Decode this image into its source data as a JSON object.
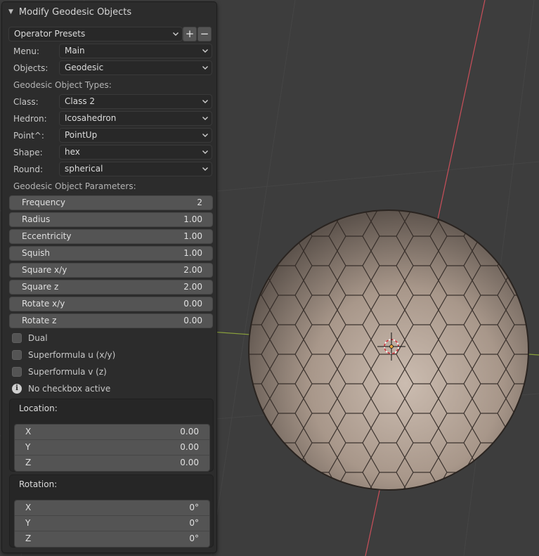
{
  "panel": {
    "title": "Modify Geodesic Objects",
    "presets_label": "Operator Presets",
    "add_symbol": "+",
    "remove_symbol": "−"
  },
  "dropdowns": {
    "menu": {
      "label": "Menu:",
      "value": "Main"
    },
    "objects": {
      "label": "Objects:",
      "value": "Geodesic"
    },
    "class": {
      "label": "Class:",
      "value": "Class 2"
    },
    "hedron": {
      "label": "Hedron:",
      "value": "Icosahedron"
    },
    "point": {
      "label": "Point^:",
      "value": "PointUp"
    },
    "shape": {
      "label": "Shape:",
      "value": "hex"
    },
    "round": {
      "label": "Round:",
      "value": "spherical"
    }
  },
  "sections": {
    "types": "Geodesic Object Types:",
    "params": "Geodesic Object Parameters:"
  },
  "params": [
    {
      "label": "Frequency",
      "value": "2"
    },
    {
      "label": "Radius",
      "value": "1.00"
    },
    {
      "label": "Eccentricity",
      "value": "1.00"
    },
    {
      "label": "Squish",
      "value": "1.00"
    },
    {
      "label": "Square x/y",
      "value": "2.00"
    },
    {
      "label": "Square z",
      "value": "2.00"
    },
    {
      "label": "Rotate x/y",
      "value": "0.00"
    },
    {
      "label": "Rotate z",
      "value": "0.00"
    }
  ],
  "checkboxes": [
    {
      "label": "Dual",
      "checked": false
    },
    {
      "label": "Superformula u (x/y)",
      "checked": false
    },
    {
      "label": "Superformula v (z)",
      "checked": false
    }
  ],
  "info": {
    "icon": "info-icon",
    "text": "No checkbox active"
  },
  "location": {
    "title": "Location:",
    "x": {
      "label": "X",
      "value": "0.00"
    },
    "y": {
      "label": "Y",
      "value": "0.00"
    },
    "z": {
      "label": "Z",
      "value": "0.00"
    }
  },
  "rotation": {
    "title": "Rotation:",
    "x": {
      "label": "X",
      "value": "0°"
    },
    "y": {
      "label": "Y",
      "value": "0°"
    },
    "z": {
      "label": "Z",
      "value": "0°"
    }
  },
  "colors": {
    "viewport_bg": "#3d3d3d",
    "panel_bg": "#2c2c2c",
    "field_bg": "#545454",
    "sphere_fill": "#b9a596",
    "x_axis": "#c94f5a",
    "y_axis": "#8aa13c"
  }
}
